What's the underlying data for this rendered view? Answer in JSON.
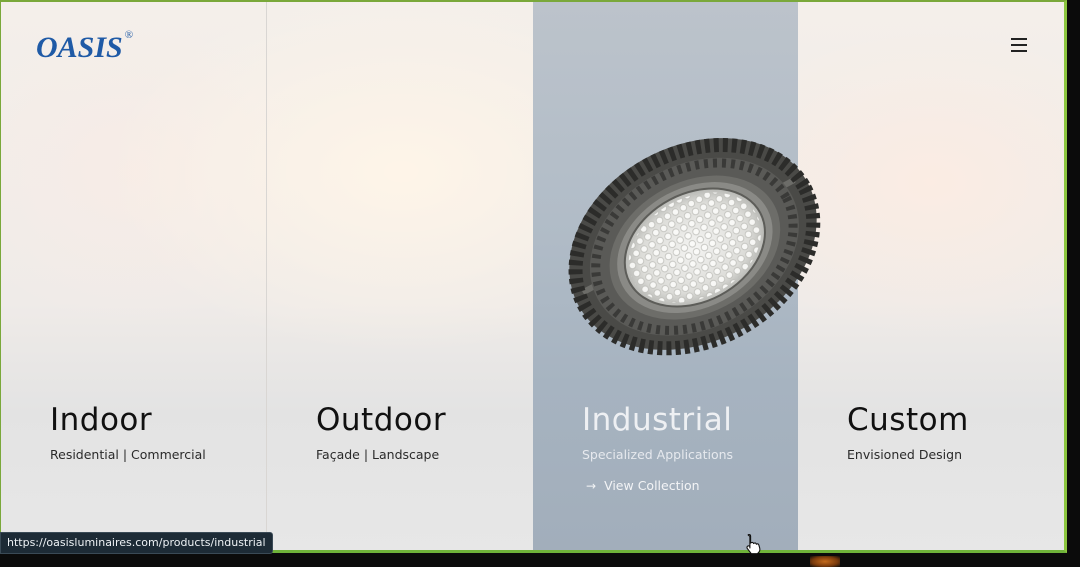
{
  "brand": {
    "name": "OASIS",
    "registered": "®"
  },
  "nav": {
    "menu_icon": "hamburger-menu-icon"
  },
  "categories": [
    {
      "title": "Indoor",
      "subtitle": "Residential | Commercial"
    },
    {
      "title": "Outdoor",
      "subtitle": "Façade | Landscape"
    },
    {
      "title": "Industrial",
      "subtitle": "Specialized Applications",
      "cta": "View Collection",
      "active": true
    },
    {
      "title": "Custom",
      "subtitle": "Envisioned Design"
    }
  ],
  "status_bar": {
    "url": "https://oasisluminaires.com/products/industrial"
  },
  "colors": {
    "brand_blue": "#1f5aa6",
    "active_panel": "#a8b4c1",
    "frame_border": "#8cc63f"
  }
}
